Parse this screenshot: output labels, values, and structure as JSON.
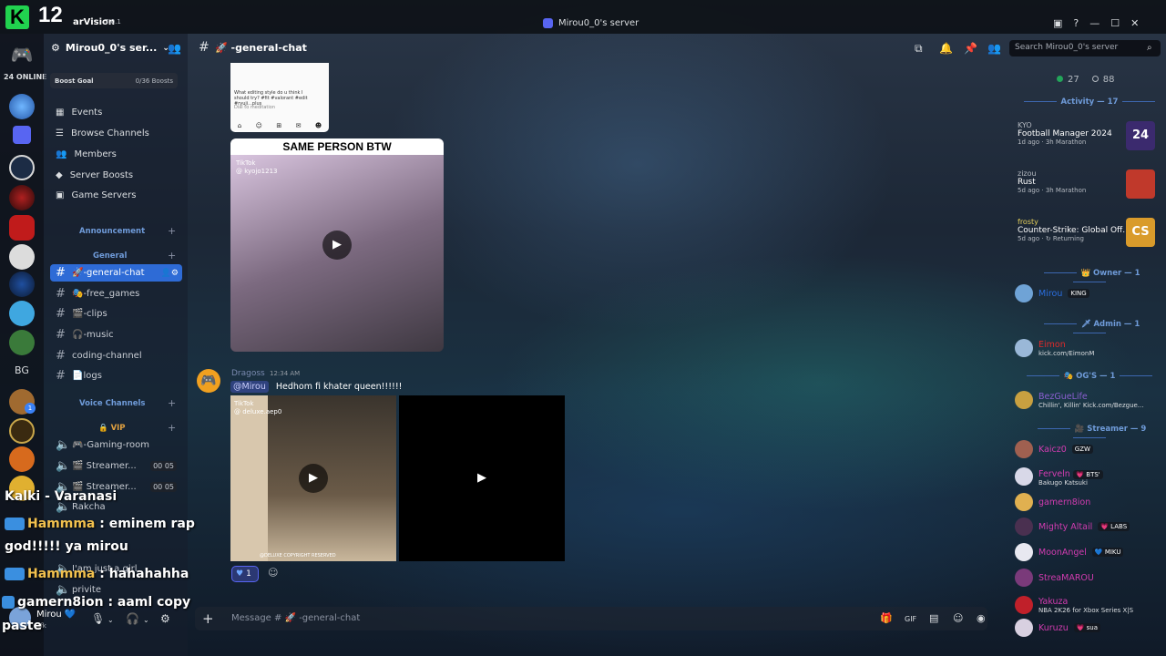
{
  "stream": {
    "logo_letter": "K",
    "logo_number": "12"
  },
  "titlebar": {
    "app_name": "arVision",
    "app_version": "7.0.1",
    "window_title": "Mirou0_0's server"
  },
  "rail": {
    "online": "24 ONLINE",
    "text_server": "BG",
    "badges": [
      "1",
      "1"
    ]
  },
  "sidebar": {
    "server_name": "Mirou0_0's ser...",
    "boost": {
      "label": "Boost Goal",
      "value": "0/36 Boosts"
    },
    "links": [
      {
        "label": "Events"
      },
      {
        "label": "Browse Channels"
      },
      {
        "label": "Members"
      },
      {
        "label": "Server Boosts"
      },
      {
        "label": "Game Servers"
      }
    ],
    "categories": {
      "announcement": "Announcement",
      "general": "General",
      "voice": "Voice Channels",
      "vip": "VIP"
    },
    "channels": [
      {
        "name": "🚀-general-chat"
      },
      {
        "name": "🎭-free_games"
      },
      {
        "name": "🎬-clips"
      },
      {
        "name": "🎧-music"
      },
      {
        "name": "coding-channel"
      },
      {
        "name": "📄logs"
      }
    ],
    "voice_channels": [
      {
        "name": "🎮-Gaming-room"
      },
      {
        "name": "🎬 Streamer...",
        "count": "00 05"
      },
      {
        "name": "🎬 Streamer...",
        "count": "00 05"
      },
      {
        "name": "Rakcha"
      },
      {
        "name": "I'am just a girl"
      },
      {
        "name": "privite"
      }
    ]
  },
  "user_panel": {
    "name": "Mirou 💙",
    "status": "afk"
  },
  "chat": {
    "channel_title": "🚀 -general-chat",
    "search_placeholder": "Search Mirou0_0's server",
    "video1_caption": "SAME PERSON BTW",
    "video1_tiktok": "TikTok",
    "video1_handle": "@ kyojo1213",
    "tt_top_text": "What editing style do u think I should try? #fit #valorant #edit #ryuji...plus",
    "tt_top_sub": "Dial to meditation",
    "message": {
      "author": "Dragoss",
      "time": "12:34 AM",
      "mention": "@Mirou",
      "text": "Hedhom  fi khater queen!!!!!!"
    },
    "video2_tiktok": "TikTok",
    "video2_handle": "@ deluxe.aep0",
    "video2_copyright": "@DELUXE   COPYRIGHT RESERVED",
    "reaction_count": "1",
    "composer_placeholder": "Message # 🚀 -general-chat"
  },
  "members": {
    "online": "27",
    "offline": "88",
    "activity_header": "Activity — 17",
    "activities": [
      {
        "user": "KYO",
        "game": "Football Manager 2024",
        "meta": "1d ago · 3h Marathon",
        "icon_text": "24",
        "icon_color": "#3b2a6e"
      },
      {
        "user": "zizou",
        "game": "Rust",
        "meta": "5d ago · 3h Marathon",
        "icon_text": "",
        "icon_color": "#c0392b"
      },
      {
        "user": "frosty",
        "game": "Counter-Strike: Global Off...",
        "meta": "5d ago · ↻ Returning",
        "icon_text": "CS",
        "icon_color": "#d99b2b"
      }
    ],
    "sections": {
      "owner": "👑 Owner — 1",
      "admin": "🗡 Admin — 1",
      "ogs": "🎭 OG'S — 1",
      "streamer": "🎥 Streamer — 9"
    },
    "owner": {
      "name": "Mirou",
      "tag": "KING"
    },
    "admin": {
      "name": "Eimon",
      "sub": "kick.com/EimonM"
    },
    "og": {
      "name": "BezGueLife",
      "sub": "Chillin', Killin' Kick.com/Bezgue..."
    },
    "streamers": [
      {
        "name": "Kaicz0",
        "tag": "GZW",
        "sub": ""
      },
      {
        "name": "Ferveln",
        "tag": "💗 BTS'",
        "sub": "Bakugo Katsuki"
      },
      {
        "name": "gamern8ion",
        "tag": "",
        "sub": ""
      },
      {
        "name": "Mighty Altail",
        "tag": "💗 LABS",
        "sub": ""
      },
      {
        "name": "MoonAngel",
        "tag": "💙 MIKU",
        "sub": ""
      },
      {
        "name": "StreaMAROU",
        "tag": "",
        "sub": ""
      },
      {
        "name": "Yakuza",
        "tag": "",
        "sub": "NBA 2K26 for Xbox Series X|S"
      },
      {
        "name": "Kuruzu",
        "tag": "💗 sua",
        "sub": ""
      }
    ]
  },
  "overlay": [
    {
      "name": "Kalki - Varanasi",
      "text": ""
    },
    {
      "name": "Hammma",
      "text": ": eminem rap"
    },
    {
      "name": "",
      "text": "god!!!!! ya mirou"
    },
    {
      "name": "Hammma",
      "text": ": hahahahha"
    },
    {
      "name": "gamern8ion",
      "text": ": aaml copy"
    },
    {
      "name": "",
      "text": "paste"
    }
  ],
  "colors": {
    "accent": "#2e6bd6",
    "online": "#23a55a",
    "kick_green": "#21d24f"
  }
}
